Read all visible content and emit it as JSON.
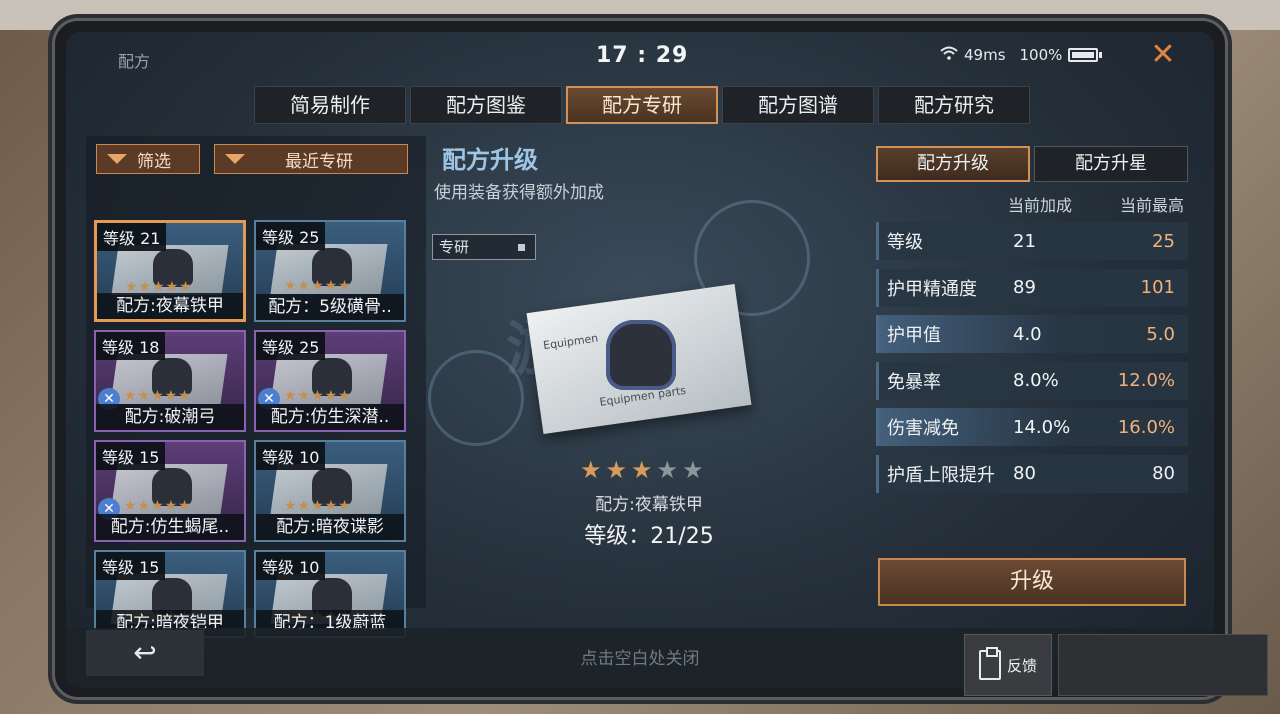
{
  "window_title": "配方",
  "clock": "17 : 29",
  "status": {
    "ping": "49ms",
    "battery": "100%"
  },
  "tabs": [
    {
      "label": "简易制作"
    },
    {
      "label": "配方图鉴"
    },
    {
      "label": "配方专研",
      "active": true
    },
    {
      "label": "配方图谱"
    },
    {
      "label": "配方研究"
    }
  ],
  "filters": {
    "filter_label": "筛选",
    "recent_label": "最近专研"
  },
  "cards": [
    {
      "level": "等级 21",
      "name": "配方:夜幕铁甲",
      "rarity": "blue",
      "stars": "★★★★★",
      "selected": true
    },
    {
      "level": "等级 25",
      "name": "配方：5级磺骨..",
      "rarity": "blue",
      "stars": "★★★★★"
    },
    {
      "level": "等级 18",
      "name": "配方:破潮弓",
      "rarity": "purple",
      "stars": "★★★★★"
    },
    {
      "level": "等级 25",
      "name": "配方:仿生深潜..",
      "rarity": "purple",
      "stars": "★★★★★"
    },
    {
      "level": "等级 15",
      "name": "配方:仿生蝎尾..",
      "rarity": "purple",
      "stars": "★★★★★"
    },
    {
      "level": "等级 10",
      "name": "配方:暗夜谍影",
      "rarity": "blue",
      "stars": "★★★★★"
    },
    {
      "level": "等级 15",
      "name": "配方:暗夜铠甲",
      "rarity": "blue",
      "stars": "★★★★★"
    },
    {
      "level": "等级 10",
      "name": "配方：1级蔚蓝",
      "rarity": "blue",
      "stars": "★★★★★"
    }
  ],
  "center": {
    "title": "配方升级",
    "subtitle": "使用装备获得额外加成",
    "toggle_label": "专研",
    "watermark": "游",
    "item_stars_on": "★★★",
    "item_stars_off": "★★",
    "item_name": "配方:夜幕铁甲",
    "item_level": "等级：21/25"
  },
  "right": {
    "sub_tabs": [
      {
        "label": "配方升级",
        "active": true
      },
      {
        "label": "配方升星"
      }
    ],
    "col_current": "当前加成",
    "col_max": "当前最高",
    "stats": [
      {
        "label": "等级",
        "current": "21",
        "max": "25",
        "upgradable": true
      },
      {
        "label": "护甲精通度",
        "current": "89",
        "max": "101",
        "upgradable": true
      },
      {
        "label": "护甲值",
        "current": "4.0",
        "max": "5.0",
        "upgradable": true
      },
      {
        "label": "免暴率",
        "current": "8.0%",
        "max": "12.0%",
        "upgradable": true
      },
      {
        "label": "伤害减免",
        "current": "14.0%",
        "max": "16.0%",
        "upgradable": true
      },
      {
        "label": "护盾上限提升",
        "current": "80",
        "max": "80",
        "upgradable": false
      }
    ],
    "upgrade_label": "升级"
  },
  "bottom": {
    "back_icon": "↩",
    "close_hint": "点击空白处关闭"
  },
  "feedback": {
    "label": "反馈"
  },
  "colors": {
    "accent": "#d0915a",
    "highlight": "#f0b27a",
    "title_blue": "#9ec6e4"
  }
}
